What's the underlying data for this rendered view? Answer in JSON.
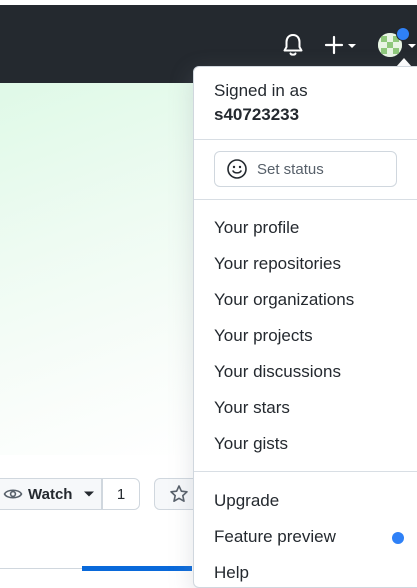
{
  "header": {
    "icons": [
      "bell-icon",
      "plus-icon",
      "caret-down-icon",
      "avatar",
      "caret-down-icon"
    ],
    "colors": {
      "background": "#24292f",
      "notification_dot": "#2f81f7"
    }
  },
  "repo_actions": {
    "watch_label": "Watch",
    "watch_count": "1"
  },
  "user_menu": {
    "signed_in_label": "Signed in as",
    "username": "s40723233",
    "set_status": "Set status",
    "items": [
      "Your profile",
      "Your repositories",
      "Your organizations",
      "Your projects",
      "Your discussions",
      "Your stars",
      "Your gists"
    ],
    "upgrade": "Upgrade",
    "feature_preview": "Feature preview",
    "partial_item": "Help"
  }
}
